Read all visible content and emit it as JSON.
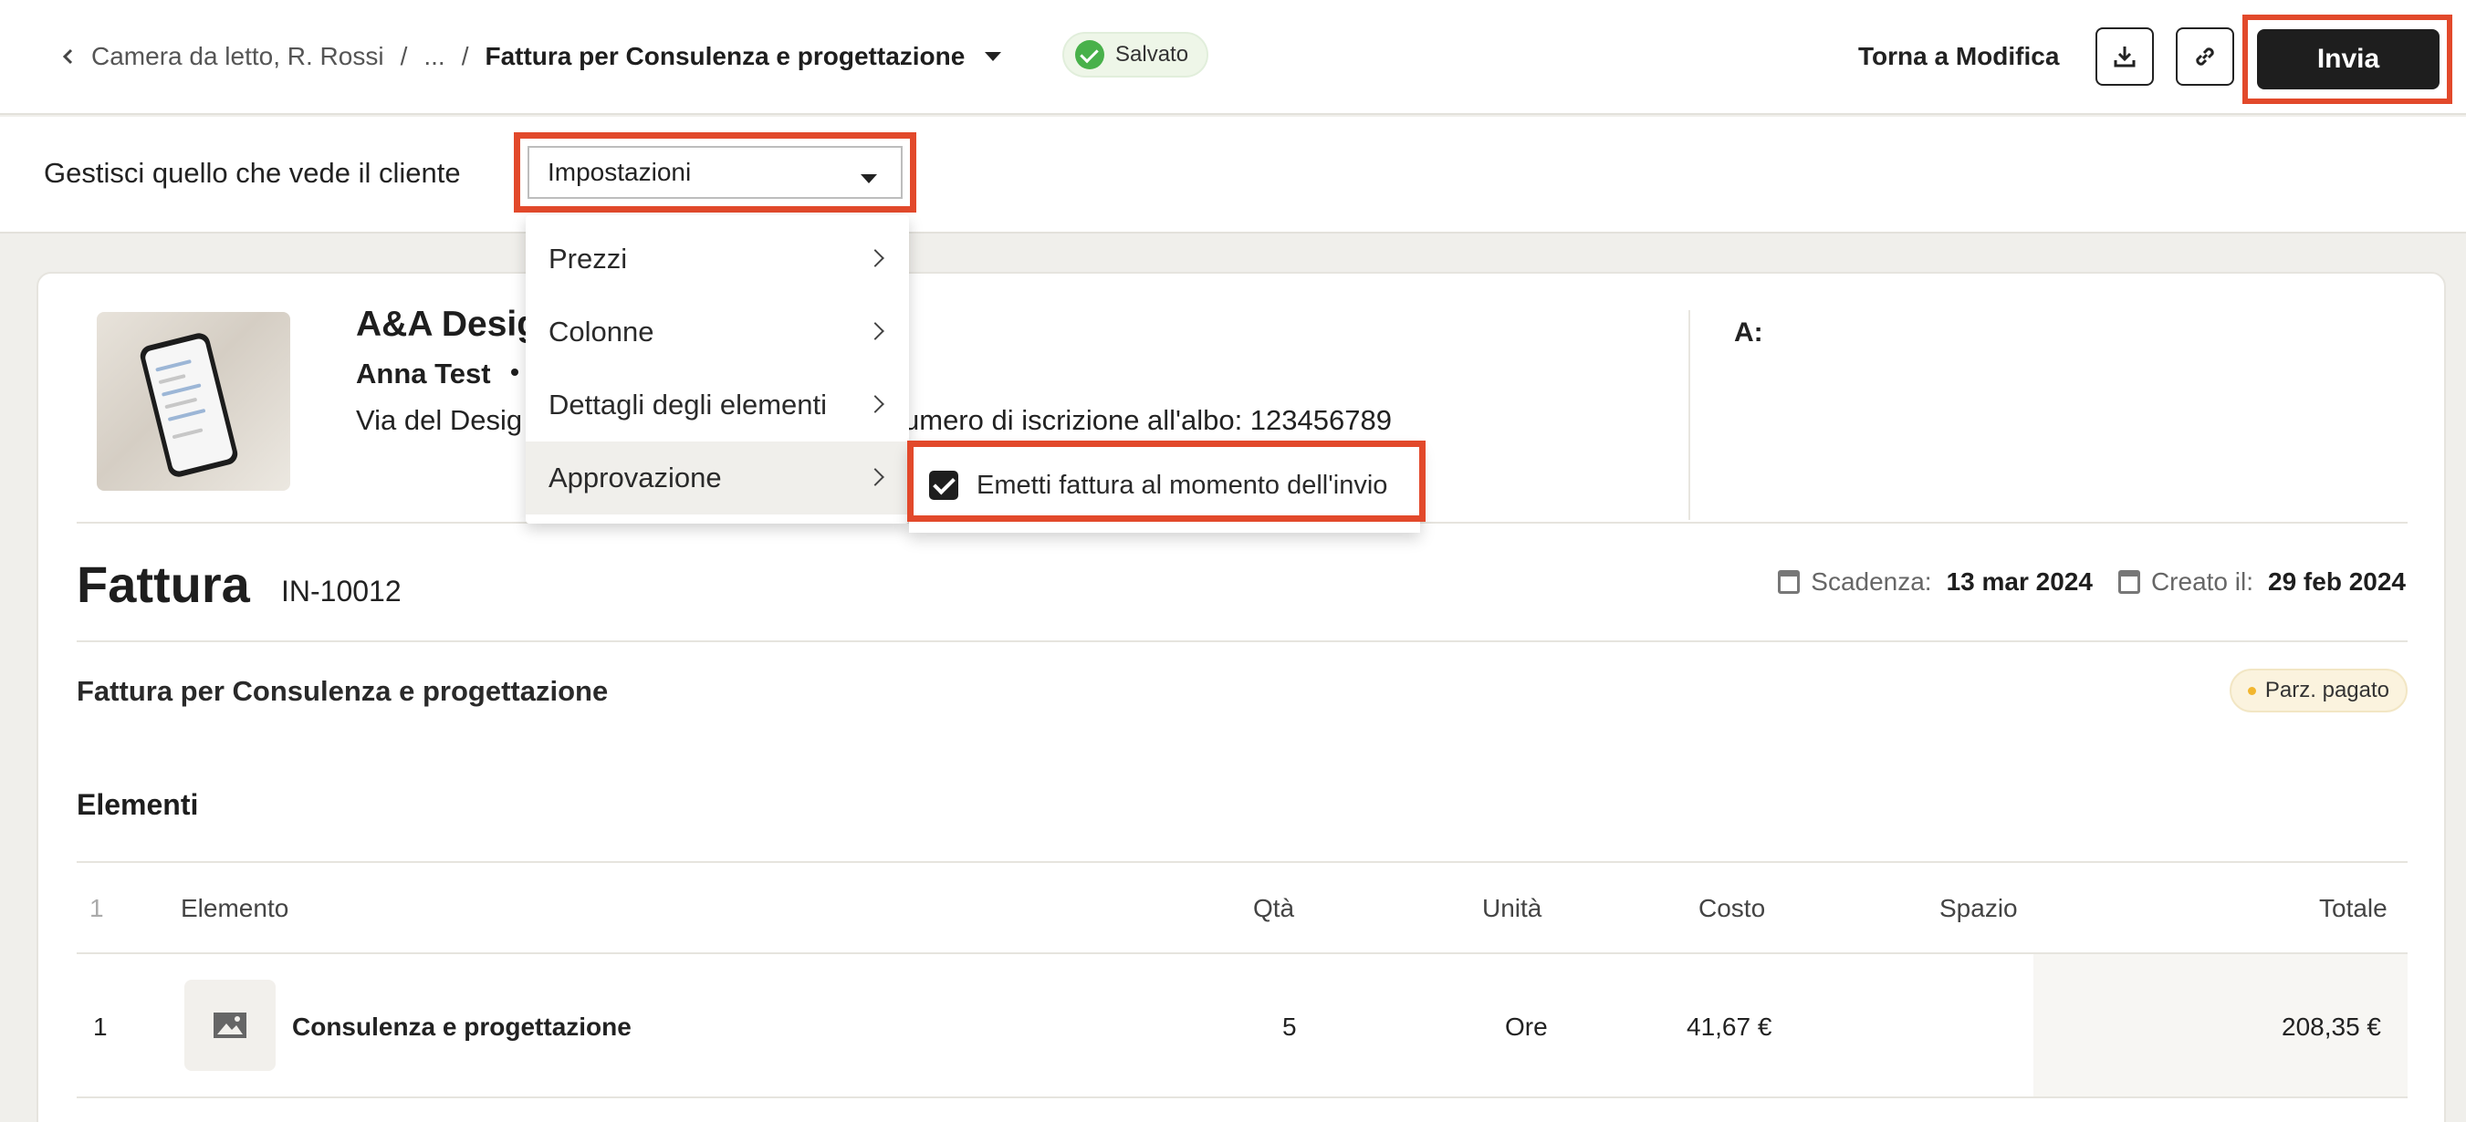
{
  "header": {
    "breadcrumb": {
      "project": "Camera da letto, R. Rossi",
      "separator": "/",
      "ellipsis": "...",
      "current": "Fattura per Consulenza e progettazione"
    },
    "status": "Salvato",
    "back_to_edit": "Torna a Modifica",
    "download_icon": "download-icon",
    "link_icon": "link-icon",
    "send_label": "Invia"
  },
  "manage": {
    "label": "Gestisci quello che vede il cliente",
    "select_value": "Impostazioni"
  },
  "menu": {
    "items": [
      {
        "label": "Prezzi"
      },
      {
        "label": "Colonne"
      },
      {
        "label": "Dettagli degli elementi"
      },
      {
        "label": "Approvazione"
      }
    ],
    "submenu": {
      "checkbox_label": "Emetti fattura al momento dell'invio",
      "checked": true
    }
  },
  "company": {
    "name": "A&A Desig",
    "contact": "Anna Test",
    "address_start": "Via del Desig",
    "address_end": "umero di iscrizione all'albo: 123456789"
  },
  "recipient": {
    "label": "A:"
  },
  "invoice": {
    "title": "Fattura",
    "number": "IN-10012",
    "due_label": "Scadenza:",
    "due_date": "13 mar 2024",
    "created_label": "Creato il:",
    "created_date": "29 feb 2024",
    "description": "Fattura per Consulenza e progettazione",
    "status_badge": "Parz. pagato",
    "status_color": "#f2b62e"
  },
  "elements": {
    "title": "Elementi",
    "columns": [
      "1",
      "Elemento",
      "Qtà",
      "Unità",
      "Costo",
      "Spazio",
      "Totale"
    ],
    "rows": [
      {
        "index": "1",
        "name": "Consulenza e progettazione",
        "qty": "5",
        "unit": "Ore",
        "cost": "41,67 €",
        "space": "",
        "total": "208,35 €"
      }
    ]
  },
  "colors": {
    "highlight": "#e2492b",
    "primary_button": "#1e1e1e",
    "saved_green": "#48b14a"
  }
}
